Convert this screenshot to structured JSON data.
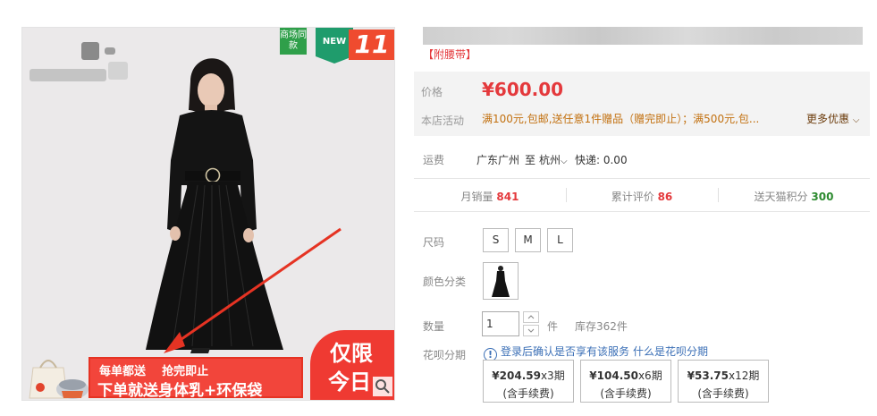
{
  "product": {
    "subtitle": "【附腰带】",
    "badges": {
      "shangchang": "商场同款",
      "new": "NEW",
      "event": "11"
    },
    "banner": {
      "line1": "每单都送    抢完即止",
      "line2": "下单就送身体乳+环保袋",
      "limit_line1": "仅限",
      "limit_line2": "今日"
    }
  },
  "price": {
    "label": "价格",
    "value": "¥600.00",
    "promo_label": "本店活动",
    "promo_text": "满100元,包邮,送任意1件赠品（赠完即止）；满500元,包...",
    "promo_more": "更多优惠"
  },
  "shipping": {
    "label": "运费",
    "from": "广东广州",
    "to_word": "至",
    "to": "杭州",
    "method": "快递: 0.00"
  },
  "stats": {
    "monthly_sales_label": "月销量",
    "monthly_sales_value": "841",
    "reviews_label": "累计评价",
    "reviews_value": "86",
    "points_label": "送天猫积分",
    "points_value": "300"
  },
  "options": {
    "size_label": "尺码",
    "sizes": [
      "S",
      "M",
      "L"
    ],
    "color_label": "颜色分类"
  },
  "quantity": {
    "label": "数量",
    "value": "1",
    "unit": "件",
    "stock": "库存362件"
  },
  "huabei": {
    "label": "花呗分期",
    "info_icon": "!",
    "info": "登录后确认是否享有该服务",
    "link": "什么是花呗分期",
    "installments": [
      {
        "amount": "¥204.59",
        "periods": "x3期",
        "fee": "(含手续费)"
      },
      {
        "amount": "¥104.50",
        "periods": "x6期",
        "fee": "(含手续费)"
      },
      {
        "amount": "¥53.75",
        "periods": "x12期",
        "fee": "(含手续费)"
      }
    ]
  },
  "colors": {
    "price_red": "#e4393c",
    "promo_orange": "#c2700f",
    "sales_red": "#e4393c",
    "points_green": "#2c8a2f",
    "banner_red": "#ef3a32",
    "link_blue": "#3b6fb6"
  }
}
